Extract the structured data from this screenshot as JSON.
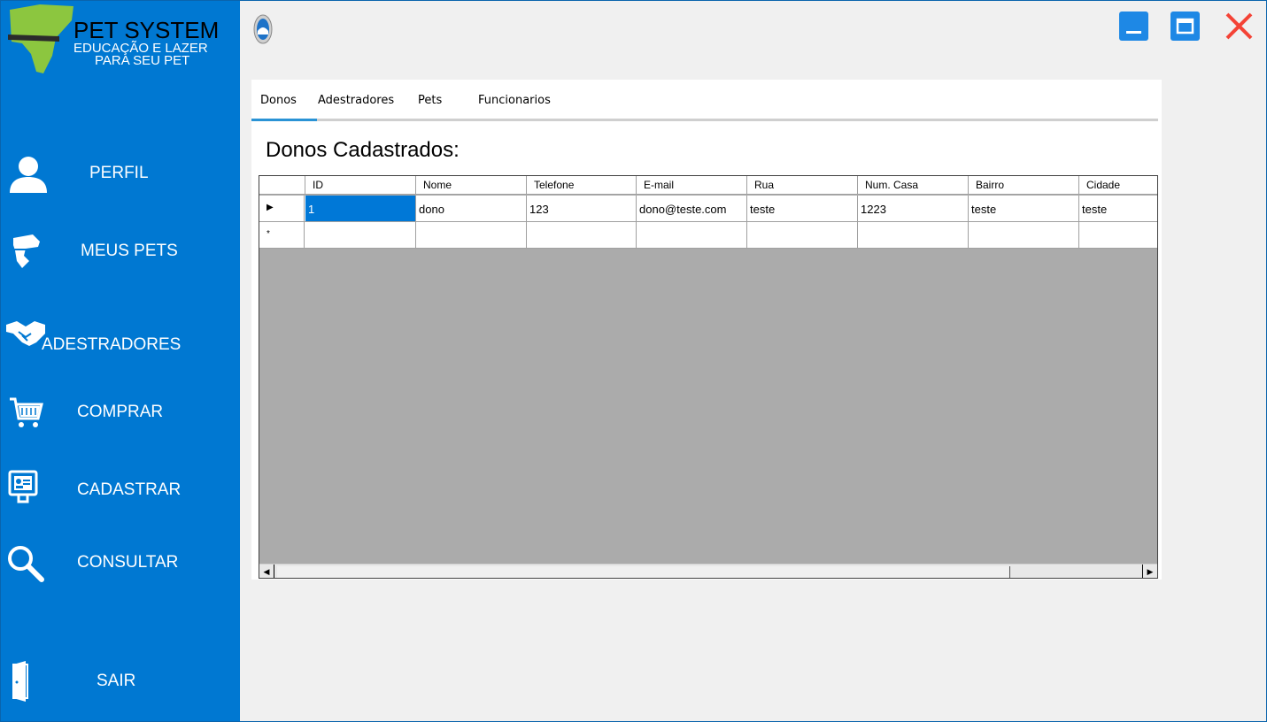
{
  "sidebar": {
    "logo": {
      "title": "PET SYSTEM",
      "subtitle_line1": "EDUCAÇÃO E LAZER",
      "subtitle_line2": "PARA SEU PET"
    },
    "items": [
      {
        "label": "PERFIL",
        "icon": "user-icon"
      },
      {
        "label": "MEUS PETS",
        "icon": "dog-head-icon"
      },
      {
        "label": "ADESTRADORES",
        "icon": "handshake-icon"
      },
      {
        "label": "COMPRAR",
        "icon": "shopping-cart-icon"
      },
      {
        "label": "CADASTRAR",
        "icon": "id-card-monitor-icon"
      },
      {
        "label": "CONSULTAR",
        "icon": "search-icon"
      },
      {
        "label": "SAIR",
        "icon": "door-exit-icon"
      }
    ],
    "background_color": "#0078d2"
  },
  "titlebar": {
    "buttons": [
      "minimize-icon",
      "maximize-icon",
      "close-icon"
    ],
    "accent_color": "#1e88e5",
    "close_color": "#f44336"
  },
  "tabs": [
    {
      "label": "Donos",
      "active": true
    },
    {
      "label": "Adestradores",
      "active": false
    },
    {
      "label": "Pets",
      "active": false
    },
    {
      "label": "Funcionarios",
      "active": false
    }
  ],
  "main": {
    "title": "Donos Cadastrados:"
  },
  "grid": {
    "columns": [
      "ID",
      "Nome",
      "Telefone",
      "E-mail",
      "Rua",
      "Num. Casa",
      "Bairro",
      "Cidade"
    ],
    "rows": [
      {
        "marker": "▶",
        "cells": [
          "1",
          "dono",
          "123",
          "dono@teste.com",
          "teste",
          "1223",
          "teste",
          "teste"
        ]
      }
    ],
    "new_row_marker": "*",
    "selected_cell": {
      "row": 0,
      "column": "ID"
    },
    "scroll_left_arrow": "◀",
    "scroll_right_arrow": "▶"
  }
}
